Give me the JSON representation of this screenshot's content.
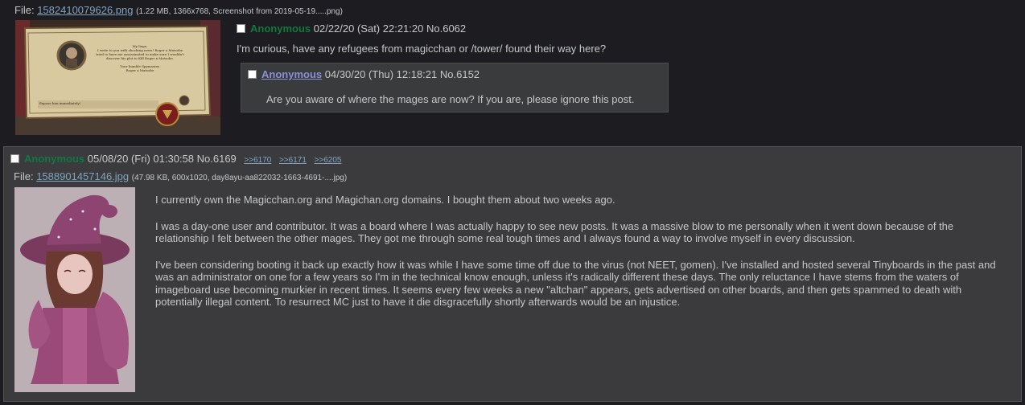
{
  "post1": {
    "file_label": "File:",
    "file_name": "1582410079626.png",
    "file_meta": "(1.22 MB, 1366x768, Screenshot from 2019-05-19.....png)",
    "thumb": {
      "letter_lines": [
        "My liege,",
        "I write to you with shocking news! Roger a Matsobe",
        "tried to have me assassinated to make sure I wouldn't",
        "discover his plot to Kill Roger a Matsobe.",
        "",
        "Your humble Spymaster,",
        "Roger a Matsobe"
      ],
      "footer_text": "Expose him immediately!"
    },
    "name": "Anonymous",
    "date": "02/22/20 (Sat) 22:21:20",
    "no": "No.6062",
    "message": "I'm curious, have any refugees from magicchan or /tower/ found their way here?"
  },
  "quote": {
    "name": "Anonymous",
    "date": "04/30/20 (Thu) 12:18:21",
    "no": "No.6152",
    "message": "Are you aware of where the mages are now? If you are, please ignore this post."
  },
  "post2": {
    "name": "Anonymous",
    "date": "05/08/20 (Fri) 01:30:58",
    "no": "No.6169",
    "backlinks": [
      ">>6170",
      ">>6171",
      ">>6205"
    ],
    "file_label": "File:",
    "file_name": "1588901457146.jpg",
    "file_meta": "(47.98 KB, 600x1020, day8ayu-aa822032-1663-4691-....jpg)",
    "paragraphs": [
      "I currently own the Magicchan.org and Magichan.org domains. I bought them about two weeks ago.",
      "I was a day-one user and contributor. It was a board where I was actually happy to see new posts. It was a massive blow to me personally when it went down because of the relationship I felt between the other mages. They got me through some real tough times and I always found a way to involve myself in every discussion.",
      "I've been considering booting it back up exactly how it was while I have some time off due to the virus (not NEET, gomen). I've installed and hosted several Tinyboards in the past and was an administrator on one for a few years so I'm in the technical know enough, unless it's radically different these days. The only reluctance I have stems from the waters of imageboard use becoming murkier in recent times. It seems every few weeks a new \"altchan\" appears, gets advertised on other boards, and then gets spammed to death with potentially illegal content. To resurrect MC just to have it die disgracefully shortly afterwards would be an injustice."
    ]
  },
  "colors": {
    "name_green": "#117743",
    "link_blue": "#81a2be",
    "text": "#c5c8c6",
    "bg": "#1d1d21"
  }
}
